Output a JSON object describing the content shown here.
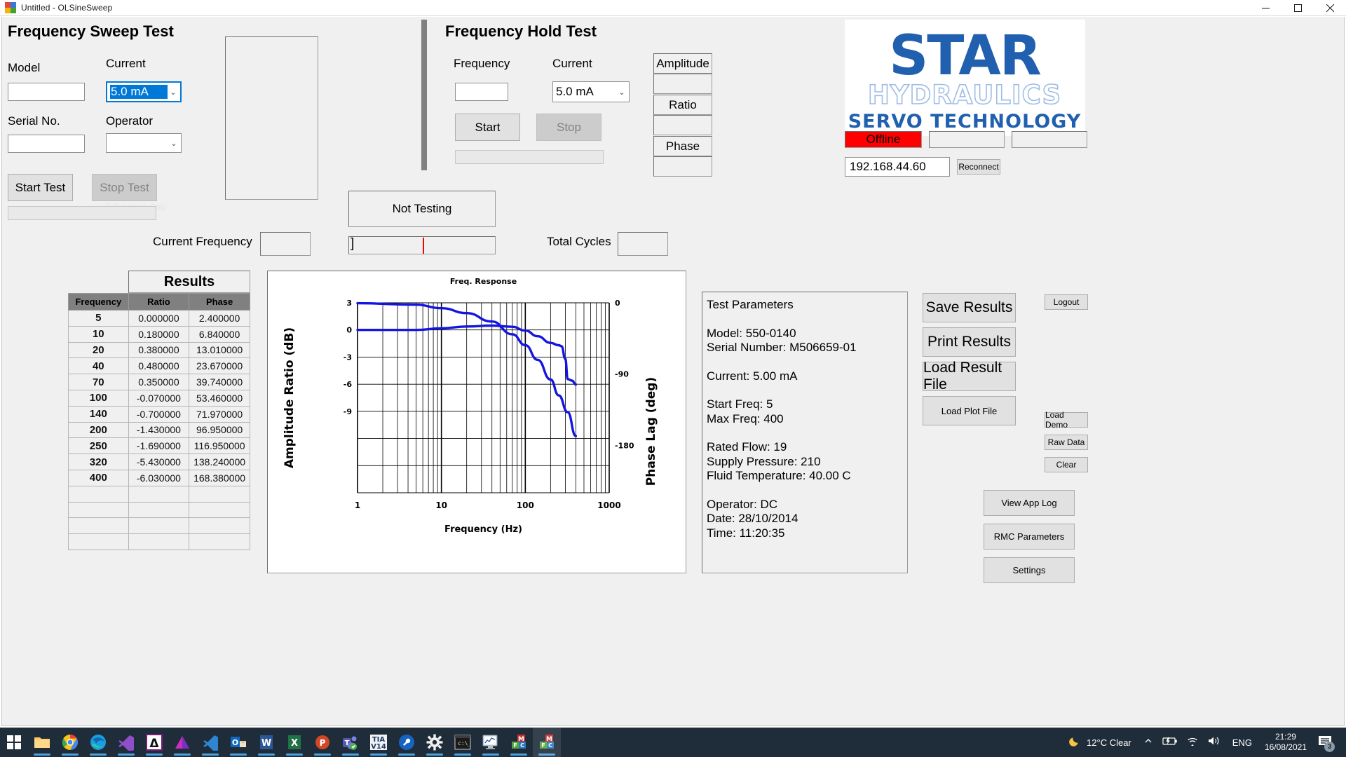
{
  "window": {
    "title": "Untitled - OLSineSweep",
    "icon": "app-chart-icon",
    "minimize": "minimize-icon",
    "maximize": "maximize-icon",
    "close": "close-icon"
  },
  "sweep": {
    "heading": "Frequency Sweep Test",
    "model_label": "Model",
    "model_value": "",
    "serial_label": "Serial No.",
    "serial_value": "",
    "current_label": "Current",
    "current_value": "5.0 mA",
    "operator_label": "Operator",
    "operator_value": "",
    "start_test": "Start Test",
    "stop_test": "Stop Test",
    "snip_ghost": "Full-screen Snip"
  },
  "hold": {
    "heading": "Frequency Hold Test",
    "frequency_label": "Frequency",
    "frequency_value": "",
    "current_label": "Current",
    "current_value": "5.0 mA",
    "start": "Start",
    "stop": "Stop"
  },
  "readouts": {
    "amplitude_label": "Amplitude",
    "amplitude_value": "",
    "ratio_label": "Ratio",
    "ratio_value": "",
    "phase_label": "Phase",
    "phase_value": ""
  },
  "status": {
    "testing_state": "Not Testing",
    "current_frequency_label": "Current Frequency",
    "current_frequency_value": "",
    "total_cycles_label": "Total Cycles",
    "total_cycles_value": "",
    "gauge_marker": "]"
  },
  "brand": {
    "star": "STAR",
    "hydraulics": "HYDRAULICS",
    "servo": "SERVO TECHNOLOGY",
    "logo_color": "#2060ae",
    "connection_state": "Offline",
    "connection_color": "#ff0000",
    "status_field_1": "",
    "status_field_2": "",
    "ip_address": "192.168.44.60",
    "reconnect": "Reconnect"
  },
  "results": {
    "title": "Results",
    "columns": [
      "Frequency",
      "Ratio",
      "Phase"
    ],
    "rows": [
      [
        "5",
        "0.000000",
        "2.400000"
      ],
      [
        "10",
        "0.180000",
        "6.840000"
      ],
      [
        "20",
        "0.380000",
        "13.010000"
      ],
      [
        "40",
        "0.480000",
        "23.670000"
      ],
      [
        "70",
        "0.350000",
        "39.740000"
      ],
      [
        "100",
        "-0.070000",
        "53.460000"
      ],
      [
        "140",
        "-0.700000",
        "71.970000"
      ],
      [
        "200",
        "-1.430000",
        "96.950000"
      ],
      [
        "250",
        "-1.690000",
        "116.950000"
      ],
      [
        "320",
        "-5.430000",
        "138.240000"
      ],
      [
        "400",
        "-6.030000",
        "168.380000"
      ],
      [
        "",
        "",
        ""
      ],
      [
        "",
        "",
        ""
      ],
      [
        "",
        "",
        ""
      ],
      [
        "",
        "",
        ""
      ]
    ]
  },
  "params": {
    "heading": "Test Parameters",
    "lines": [
      "Model: 550-0140",
      "Serial Number: M506659-01",
      "",
      "Current: 5.00 mA",
      "",
      "Start Freq: 5",
      "Max Freq: 400",
      "",
      "Rated Flow: 19",
      "Supply Pressure: 210",
      "Fluid Temperature: 40.00 C",
      "",
      "Operator: DC",
      "Date: 28/10/2014",
      "Time: 11:20:35"
    ]
  },
  "actions": {
    "save_results": "Save Results",
    "print_results": "Print Results",
    "load_result_file": "Load Result File",
    "load_plot_file": "Load Plot File",
    "logout": "Logout",
    "load_demo": "Load Demo",
    "raw_data": "Raw Data",
    "clear": "Clear",
    "view_app_log": "View App Log",
    "rmc_parameters": "RMC Parameters",
    "settings": "Settings"
  },
  "chart_data": {
    "type": "line",
    "title": "Freq. Response",
    "xlabel": "Frequency (Hz)",
    "ylabel": "Amplitude Ratio (dB)",
    "y2label": "Phase Lag (deg)",
    "xscale": "log",
    "xlim": [
      1,
      1000
    ],
    "xticks": [
      1,
      10,
      100,
      1000
    ],
    "xtick_labels": [
      "1",
      "10",
      "100",
      "1000"
    ],
    "ylim": [
      -18,
      3
    ],
    "yticks": [
      3,
      0,
      -3,
      -6,
      -9
    ],
    "ytick_labels": [
      "3",
      "0",
      "-3",
      "-6",
      "-9"
    ],
    "y2lim": [
      -240,
      0
    ],
    "y2ticks": [
      -180,
      -90,
      0
    ],
    "y2tick_labels": [
      "-180",
      "-90",
      "0"
    ],
    "grid": true,
    "line_color": "#1515e0",
    "series": [
      {
        "name": "Amplitude Ratio (dB)",
        "axis": "left",
        "x": [
          1,
          5,
          10,
          20,
          40,
          70,
          100,
          140,
          200,
          250,
          270,
          300,
          320,
          360,
          400
        ],
        "y": [
          0.0,
          0.0,
          0.18,
          0.38,
          0.48,
          0.35,
          -0.07,
          -0.7,
          -1.43,
          -1.69,
          -1.8,
          -3.2,
          -5.43,
          -5.6,
          -6.03
        ]
      },
      {
        "name": "Phase Lag (deg)",
        "axis": "right",
        "x": [
          1,
          5,
          10,
          20,
          40,
          70,
          100,
          140,
          200,
          250,
          320,
          400
        ],
        "y": [
          -0.5,
          -2.4,
          -6.84,
          -13.01,
          -23.67,
          -39.74,
          -53.46,
          -71.97,
          -96.95,
          -116.95,
          -138.24,
          -168.38
        ]
      }
    ]
  },
  "taskbar": {
    "icons": [
      "windows-start-icon",
      "file-explorer-icon",
      "chrome-icon",
      "edge-icon",
      "visual-studio-icon",
      "autocad-icon",
      "inventor-icon",
      "vscode-icon",
      "outlook-icon",
      "word-icon",
      "excel-icon",
      "powerpoint-icon",
      "teams-icon",
      "tia-portal-v14-icon",
      "wrench-tool-icon",
      "settings-gear-icon",
      "command-prompt-icon",
      "plot-monitor-icon",
      "mfc-app-icon",
      "mfc-app-active-icon"
    ],
    "tray": {
      "weather_icon": "moon-icon",
      "weather": "12°C  Clear",
      "chevron": "show-hidden-icon",
      "battery": "battery-icon",
      "network": "wifi-icon",
      "volume": "speaker-icon",
      "language": "ENG",
      "time": "21:29",
      "date": "16/08/2021",
      "notifications_icon": "notifications-icon",
      "notifications_count": "3"
    }
  }
}
